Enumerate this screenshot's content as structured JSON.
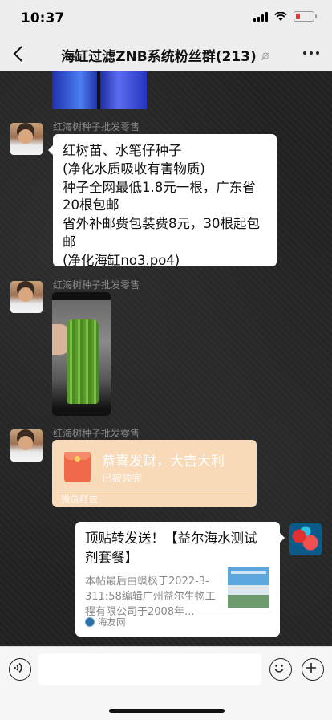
{
  "status": {
    "time": "10:37"
  },
  "header": {
    "title": "海缸过滤ZNB系统粉丝群(213)"
  },
  "messages": {
    "sender_name": "红海树种子批发零售",
    "text_message": "红树苗、水笔仔种子\n(净化水质吸收有害物质)\n种子全网最低1.8元一根，广东省20根包邮\n省外补邮费包装费8元，30根起包邮\n(净化海缸no3.po4)",
    "red_packet": {
      "title": "恭喜发财，大吉大利",
      "status": "已被领完",
      "footer": "微信红包"
    },
    "link_card": {
      "title": "顶贴转发送！【益尔海水测试剂套餐】",
      "description": "本帖最后由飒枫于2022-3-311:58编辑广州益尔生物工程有限公司于2008年...",
      "source": "海友网"
    }
  },
  "input": {
    "placeholder": ""
  }
}
